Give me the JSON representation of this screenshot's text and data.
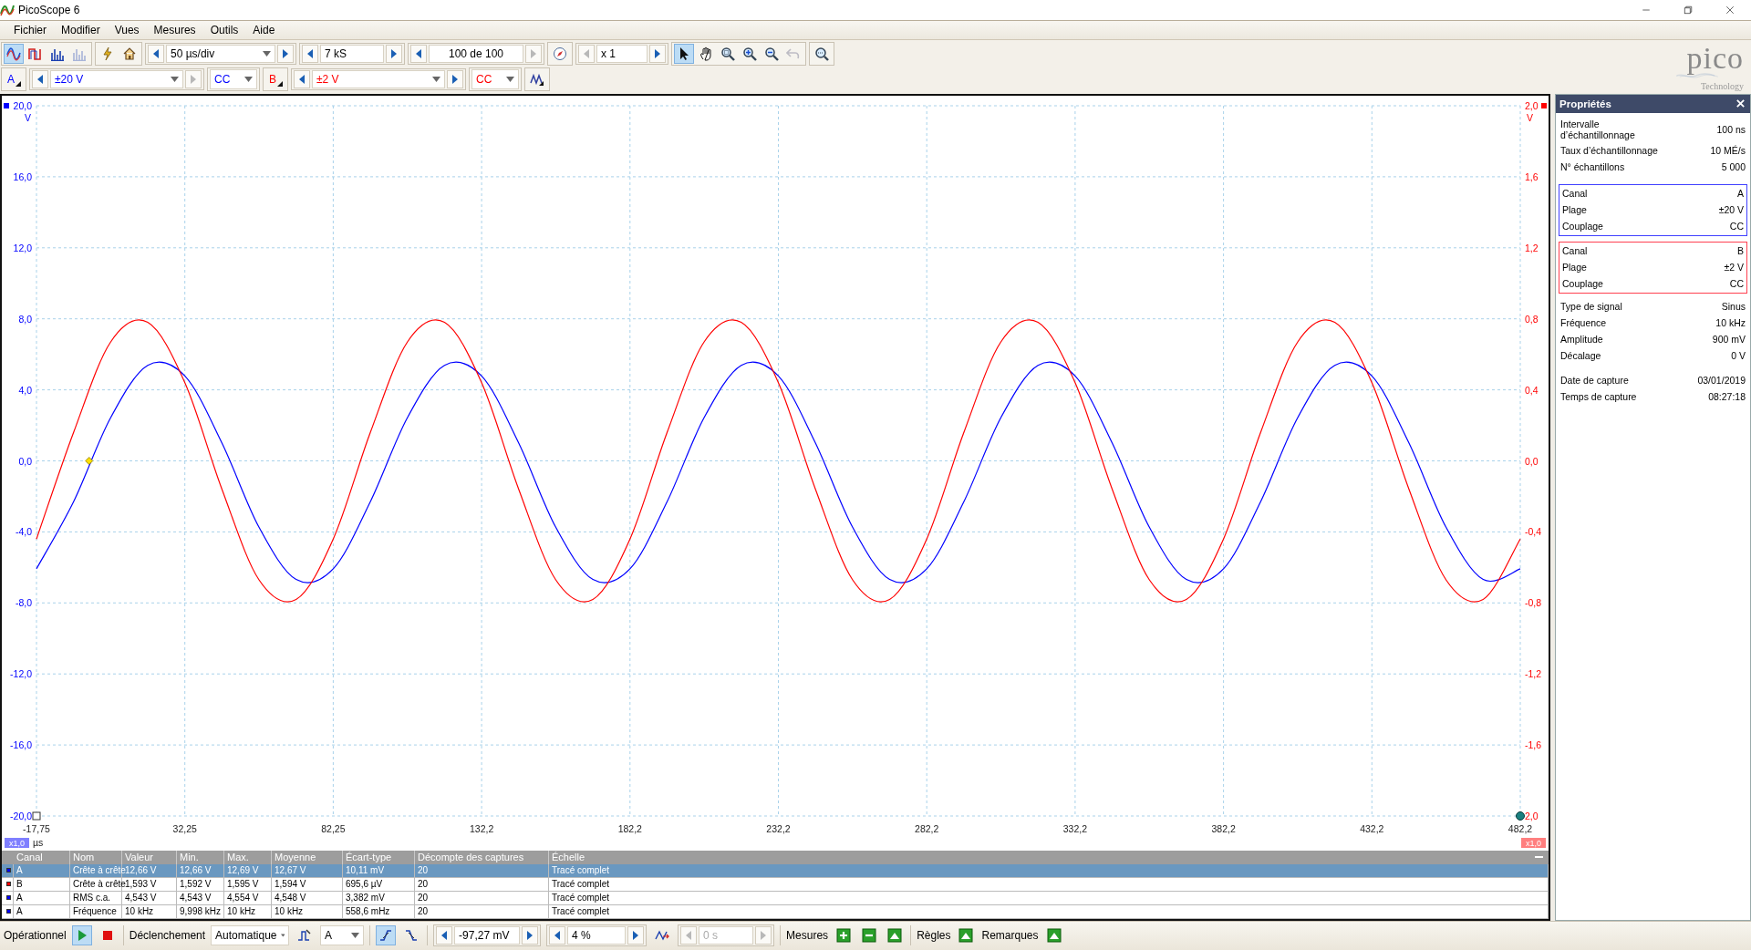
{
  "window": {
    "title": "PicoScope 6"
  },
  "menu": [
    "Fichier",
    "Modifier",
    "Vues",
    "Mesures",
    "Outils",
    "Aide"
  ],
  "toolbar": {
    "modes": [
      {
        "kind": "scope",
        "selected": true,
        "disabled": false
      },
      {
        "kind": "persistence",
        "selected": false,
        "disabled": false
      },
      {
        "kind": "spectrum",
        "selected": false,
        "disabled": false
      },
      {
        "kind": "spectrum",
        "selected": false,
        "disabled": true
      }
    ],
    "timebase": {
      "value": "50 µs/div",
      "back_disabled": false,
      "forward_disabled": false
    },
    "samples": {
      "value": "7 kS",
      "back_disabled": false,
      "forward_disabled": false
    },
    "buffer": {
      "value": "100 de 100",
      "back_disabled": false,
      "forward_disabled": true
    },
    "zoom": {
      "value": "x 1",
      "back_disabled": true,
      "forward_disabled": false
    },
    "tools": [
      {
        "kind": "pointer",
        "selected": true,
        "disabled": false
      },
      {
        "kind": "hand",
        "selected": false,
        "disabled": false
      },
      {
        "kind": "zoom-area",
        "selected": false,
        "disabled": false
      },
      {
        "kind": "zoom-in",
        "selected": false,
        "disabled": false
      },
      {
        "kind": "zoom-out",
        "selected": false,
        "disabled": false
      },
      {
        "kind": "undo-zoom",
        "selected": false,
        "disabled": true
      }
    ]
  },
  "channels": [
    {
      "name": "A",
      "color": "#0000ff",
      "range": {
        "value": "±20 V",
        "back_disabled": false,
        "forward_disabled": true
      },
      "coupling": "CC"
    },
    {
      "name": "B",
      "color": "#ff0000",
      "range": {
        "value": "±2 V",
        "back_disabled": false,
        "forward_disabled": false
      },
      "coupling": "CC"
    }
  ],
  "logo": {
    "name": "pico",
    "tagline": "Technology"
  },
  "scope": {
    "zoom_badges": [
      "x1,0",
      "x1,0"
    ],
    "chart_data": {
      "type": "line",
      "grid": true,
      "xlabel": "µs",
      "ylabel": "V",
      "y2label": "V",
      "xlim": [
        -17.75,
        482.25
      ],
      "ylim": [
        -20,
        20
      ],
      "y2lim": [
        -2,
        2
      ],
      "xticks": [
        {
          "value": -17.75,
          "label": "-17,75"
        },
        {
          "value": 32.25,
          "label": "32,25"
        },
        {
          "value": 82.25,
          "label": "82,25"
        },
        {
          "value": 132.25,
          "label": "132,2"
        },
        {
          "value": 182.25,
          "label": "182,2"
        },
        {
          "value": 232.25,
          "label": "232,2"
        },
        {
          "value": 282.25,
          "label": "282,2"
        },
        {
          "value": 332.25,
          "label": "332,2"
        },
        {
          "value": 382.25,
          "label": "382,2"
        },
        {
          "value": 432.25,
          "label": "432,2"
        },
        {
          "value": 482.25,
          "label": "482,2"
        }
      ],
      "yticks": [
        {
          "value": 20,
          "label": "20,0"
        },
        {
          "value": 16,
          "label": "16,0"
        },
        {
          "value": 12,
          "label": "12,0"
        },
        {
          "value": 8,
          "label": "8,0"
        },
        {
          "value": 4,
          "label": "4,0"
        },
        {
          "value": 0,
          "label": "0,0"
        },
        {
          "value": -4,
          "label": "-4,0"
        },
        {
          "value": -8,
          "label": "-8,0"
        },
        {
          "value": -12,
          "label": "-12,0"
        },
        {
          "value": -16,
          "label": "-16,0"
        },
        {
          "value": -20,
          "label": "-20,0"
        }
      ],
      "y2ticks": [
        {
          "value": 2,
          "label": "2,0"
        },
        {
          "value": 1.6,
          "label": "1,6"
        },
        {
          "value": 1.2,
          "label": "1,2"
        },
        {
          "value": 0.8,
          "label": "0,8"
        },
        {
          "value": 0.4,
          "label": "0,4"
        },
        {
          "value": 0,
          "label": "0,0"
        },
        {
          "value": -0.4,
          "label": "-0,4"
        },
        {
          "value": -0.8,
          "label": "-0,8"
        },
        {
          "value": -1.2,
          "label": "-1,2"
        },
        {
          "value": -1.6,
          "label": "-1,6"
        },
        {
          "value": -2,
          "label": "2,0"
        }
      ],
      "x": [
        -17.75,
        -5.25,
        7.25,
        19.75,
        32.25,
        44.75,
        57.25,
        69.75,
        82.25,
        94.75,
        107.25,
        119.75,
        132.25,
        144.75,
        157.25,
        169.75,
        182.25,
        194.75,
        207.25,
        219.75,
        232.25,
        244.75,
        257.25,
        269.75,
        282.25,
        294.75,
        307.25,
        319.75,
        332.25,
        344.75,
        357.25,
        369.75,
        382.25,
        394.75,
        407.25,
        419.75,
        432.25,
        444.75,
        457.25,
        469.75,
        482.25
      ],
      "series": [
        {
          "color": "#0000ff",
          "values": [
            -6.08,
            -2.3,
            2.44,
            5.38,
            4.78,
            1.0,
            -3.74,
            -6.68,
            -6.08,
            -2.3,
            2.44,
            5.38,
            4.78,
            1.0,
            -3.74,
            -6.68,
            -6.08,
            -2.3,
            2.44,
            5.38,
            4.78,
            1.0,
            -3.74,
            -6.68,
            -6.08,
            -2.3,
            2.44,
            5.38,
            4.78,
            1.0,
            -3.74,
            -6.68,
            -6.08,
            -2.3,
            2.44,
            5.38,
            4.78,
            1.0,
            -3.74,
            -6.68,
            -6.08
          ]
        },
        {
          "color": "#ff0000",
          "axis": "y2",
          "values": [
            -0.44,
            0.16,
            0.67,
            0.78,
            0.44,
            -0.16,
            -0.67,
            -0.78,
            -0.44,
            0.16,
            0.67,
            0.78,
            0.44,
            -0.16,
            -0.67,
            -0.78,
            -0.44,
            0.16,
            0.67,
            0.78,
            0.44,
            -0.16,
            -0.67,
            -0.78,
            -0.44,
            0.16,
            0.67,
            0.78,
            0.44,
            -0.16,
            -0.67,
            -0.78,
            -0.44,
            0.16,
            0.67,
            0.78,
            0.44,
            -0.16,
            -0.67,
            -0.78,
            -0.44
          ]
        }
      ]
    }
  },
  "measurements": {
    "columns": [
      "Canal",
      "Nom",
      "Valeur",
      "Min.",
      "Max.",
      "Moyenne",
      "Écart-type",
      "Décompte des captures",
      "Échelle"
    ],
    "rows": [
      {
        "color": "#0000ff",
        "selected": true,
        "cells": [
          "A",
          "Crête à crête",
          "12,66 V",
          "12,66 V",
          "12,69 V",
          "12,67 V",
          "10,11 mV",
          "20",
          "Tracé complet"
        ]
      },
      {
        "color": "#ff0000",
        "selected": false,
        "cells": [
          "B",
          "Crête à crête",
          "1,593 V",
          "1,592 V",
          "1,595 V",
          "1,594 V",
          "695,6 µV",
          "20",
          "Tracé complet"
        ]
      },
      {
        "color": "#0000ff",
        "selected": false,
        "cells": [
          "A",
          "RMS c.a.",
          "4,543 V",
          "4,543 V",
          "4,554 V",
          "4,548 V",
          "3,382 mV",
          "20",
          "Tracé complet"
        ]
      },
      {
        "color": "#0000ff",
        "selected": false,
        "cells": [
          "A",
          "Fréquence",
          "10 kHz",
          "9,998 kHz",
          "10 kHz",
          "10 kHz",
          "558,6 mHz",
          "20",
          "Tracé complet"
        ]
      }
    ]
  },
  "properties": {
    "title": "Propriétés",
    "sections": [
      {
        "kind": "plain",
        "rows": [
          {
            "label": "Intervalle d’échantillonnage",
            "value": "100 ns"
          },
          {
            "label": "Taux d’échantillonnage",
            "value": "10 MÉ/s"
          },
          {
            "label": "N° échantillons",
            "value": "5 000"
          }
        ]
      },
      {
        "kind": "boxed",
        "color": "#4040ff",
        "rows": [
          {
            "label": "Canal",
            "value": "A"
          },
          {
            "label": "Plage",
            "value": "±20 V"
          },
          {
            "label": "Couplage",
            "value": "CC"
          }
        ]
      },
      {
        "kind": "boxed",
        "color": "#ff4050",
        "rows": [
          {
            "label": "Canal",
            "value": "B"
          },
          {
            "label": "Plage",
            "value": "±2 V"
          },
          {
            "label": "Couplage",
            "value": "CC"
          }
        ]
      },
      {
        "kind": "plain",
        "rows": [
          {
            "label": "Type de signal",
            "value": "Sinus"
          },
          {
            "label": "Fréquence",
            "value": "10 kHz"
          },
          {
            "label": "Amplitude",
            "value": "900 mV"
          },
          {
            "label": "Décalage",
            "value": "0 V"
          }
        ]
      },
      {
        "kind": "plain",
        "rows": [
          {
            "label": "Date de capture",
            "value": "03/01/2019"
          },
          {
            "label": "Temps de capture",
            "value": "08:27:18"
          }
        ]
      }
    ]
  },
  "trigger_bar": {
    "status_label": "Opérationnel",
    "running": true,
    "trigger_label": "Déclenchement",
    "mode": "Automatique",
    "source": "A",
    "edges": [
      {
        "kind": "rising",
        "selected": true
      },
      {
        "kind": "falling",
        "selected": false
      }
    ],
    "threshold": {
      "value": "-97,27 mV",
      "back_disabled": false,
      "forward_disabled": false
    },
    "pretrigger": {
      "value": "4 %",
      "back_disabled": false,
      "forward_disabled": false
    },
    "delay": {
      "value": "0 s",
      "back_disabled": true,
      "forward_disabled": true,
      "disabled": true
    },
    "measurements_label": "Mesures",
    "rulers_label": "Règles",
    "notes_label": "Remarques"
  }
}
